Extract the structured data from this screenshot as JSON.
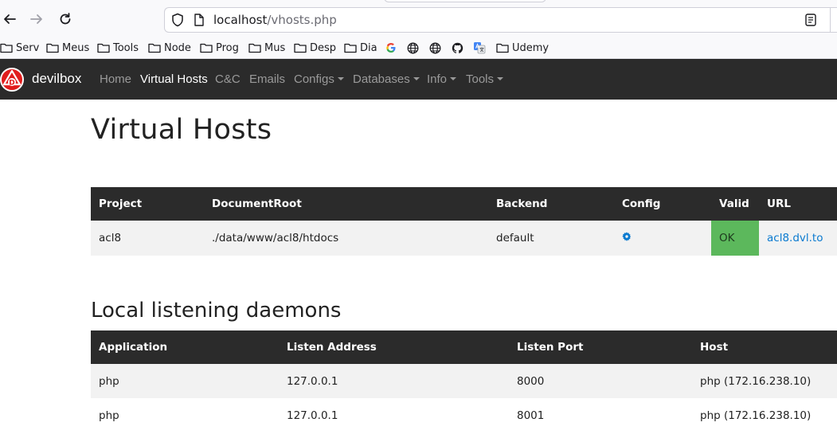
{
  "browser": {
    "url_host": "localhost",
    "url_path": "/vhosts.php"
  },
  "bookmarks": [
    {
      "label": "Serv",
      "icon": "folder-icon"
    },
    {
      "label": "Meus",
      "icon": "folder-icon"
    },
    {
      "label": "Tools",
      "icon": "folder-icon"
    },
    {
      "label": "Node",
      "icon": "folder-icon"
    },
    {
      "label": "Prog",
      "icon": "folder-icon"
    },
    {
      "label": "Mus",
      "icon": "folder-icon"
    },
    {
      "label": "Desp",
      "icon": "folder-icon"
    },
    {
      "label": "Dia",
      "icon": "folder-icon"
    },
    {
      "label": "",
      "icon": "google-icon"
    },
    {
      "label": "",
      "icon": "globe-icon"
    },
    {
      "label": "",
      "icon": "globe-icon"
    },
    {
      "label": "",
      "icon": "github-icon"
    },
    {
      "label": "",
      "icon": "translate-icon"
    },
    {
      "label": "Udemy",
      "icon": "folder-icon"
    }
  ],
  "navbar": {
    "brand": "devilbox",
    "items": [
      {
        "label": "Home"
      },
      {
        "label": "Virtual Hosts"
      },
      {
        "label": "C&C"
      },
      {
        "label": "Emails"
      },
      {
        "label": "Configs"
      },
      {
        "label": "Databases"
      },
      {
        "label": "Info"
      },
      {
        "label": "Tools"
      }
    ]
  },
  "page": {
    "title": "Virtual Hosts",
    "vhosts_table": {
      "headers": [
        "Project",
        "DocumentRoot",
        "Backend",
        "Config",
        "Valid",
        "URL"
      ],
      "rows": [
        {
          "project": "acl8",
          "document_root": "./data/www/acl8/htdocs",
          "backend": "default",
          "valid": "OK",
          "url": "acl8.dvl.to"
        }
      ]
    },
    "daemons_title": "Local listening daemons",
    "daemons_table": {
      "headers": [
        "Application",
        "Listen Address",
        "Listen Port",
        "Host"
      ],
      "rows": [
        {
          "application": "php",
          "address": "127.0.0.1",
          "port": "8000",
          "host": "php (172.16.238.10)"
        },
        {
          "application": "php",
          "address": "127.0.0.1",
          "port": "8001",
          "host": "php (172.16.238.10)"
        }
      ]
    }
  },
  "colors": {
    "navbar_bg": "#2b2b2b",
    "valid_ok": "#5cb85c",
    "link": "#0a7ad0"
  }
}
